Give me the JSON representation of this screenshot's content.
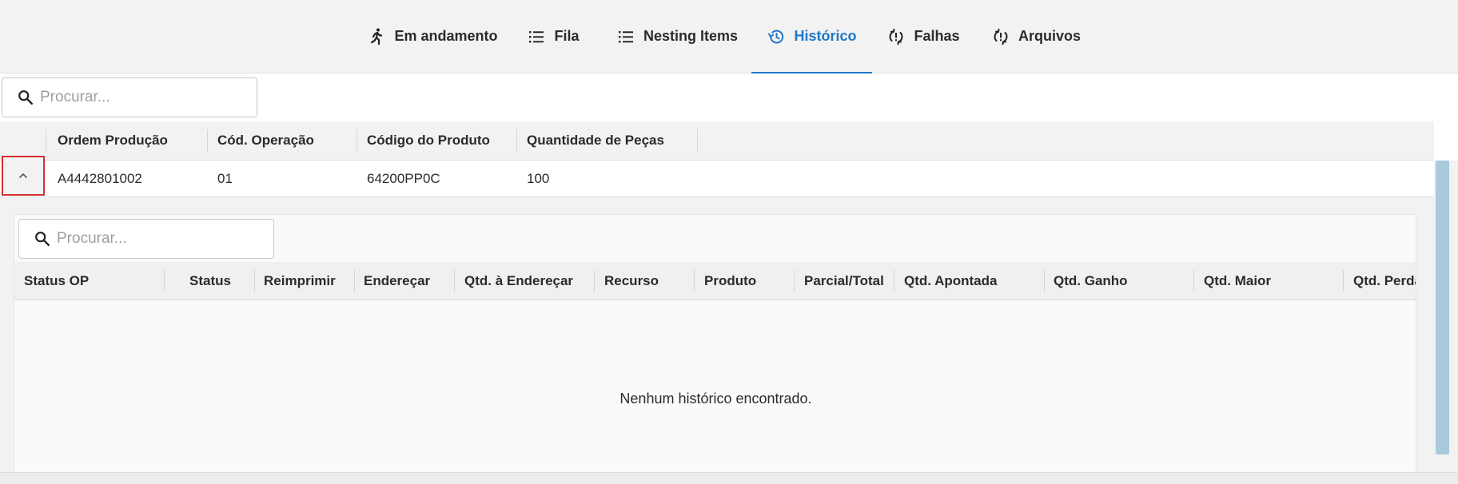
{
  "tabs": [
    {
      "label": "Em andamento",
      "icon": "running-person-icon",
      "active": false
    },
    {
      "label": "Fila",
      "icon": "list-icon",
      "active": false
    },
    {
      "label": "Nesting Items",
      "icon": "list-icon",
      "active": false
    },
    {
      "label": "Histórico",
      "icon": "history-icon",
      "active": true
    },
    {
      "label": "Falhas",
      "icon": "sync-alert-icon",
      "active": false
    },
    {
      "label": "Arquivos",
      "icon": "sync-alert-icon",
      "active": false
    }
  ],
  "search": {
    "placeholder": "Procurar..."
  },
  "orders_table": {
    "columns": [
      "Ordem Produção",
      "Cód. Operação",
      "Código do Produto",
      "Quantidade de Peças"
    ],
    "rows": [
      {
        "ordem_producao": "A4442801002",
        "cod_operacao": "01",
        "codigo_produto": "64200PP0C",
        "quantidade_pecas": "100",
        "expanded": true
      }
    ]
  },
  "history_panel": {
    "search_placeholder": "Procurar...",
    "columns": [
      "Status OP",
      "Status",
      "Reimprimir",
      "Endereçar",
      "Qtd. à Endereçar",
      "Recurso",
      "Produto",
      "Parcial/Total",
      "Qtd. Apontada",
      "Qtd. Ganho",
      "Qtd. Maior",
      "Qtd. Perda"
    ],
    "empty_message": "Nenhum histórico encontrado."
  },
  "colors": {
    "accent": "#1f77c8",
    "highlight_border": "#d32f2f",
    "scroll_thumb": "#a9c9dc"
  }
}
